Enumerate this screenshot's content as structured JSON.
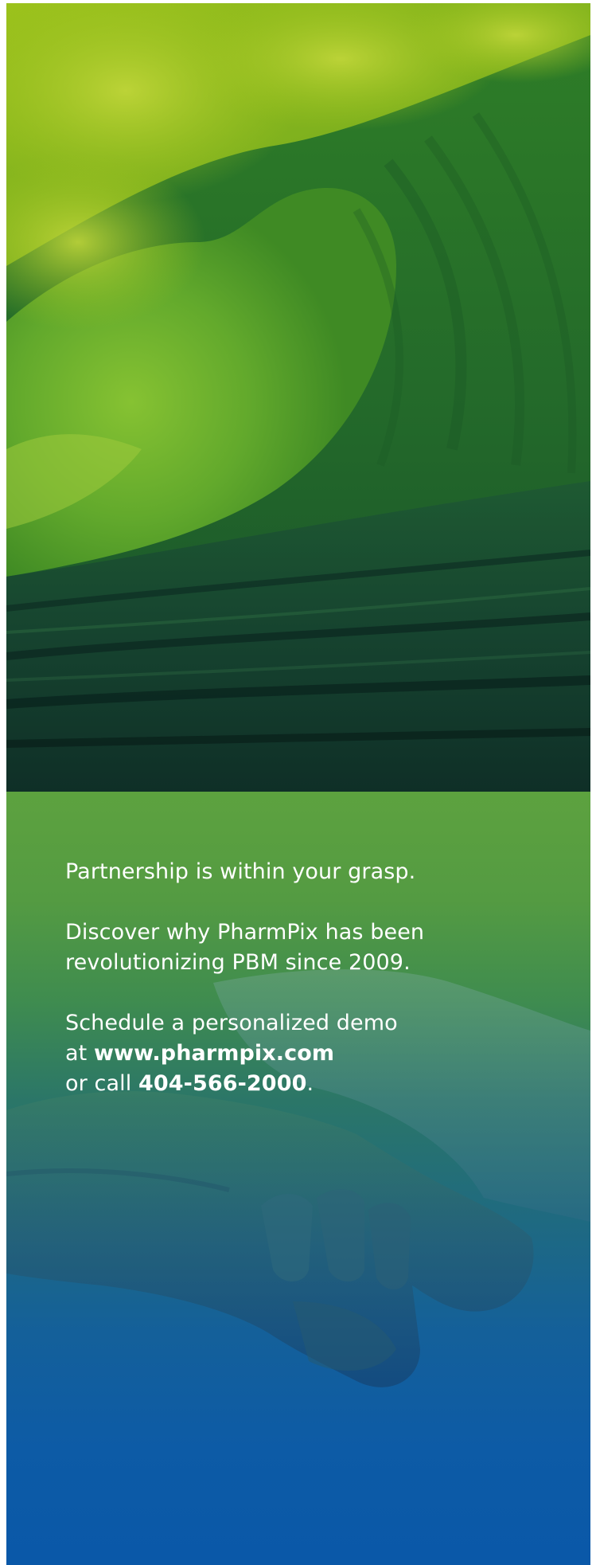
{
  "ad": {
    "images": {
      "top": "ocean-wave-photo",
      "bottom": "clasped-hands-photo"
    },
    "colors": {
      "wave_highlight": "#a8c81e",
      "wave_green": "#2f7d23",
      "sea_dark": "#0f2f27",
      "panel_top": "#5da23f",
      "panel_bottom": "#0a58a8",
      "text": "#ffffff"
    },
    "copy": {
      "line1": "Partnership is within your grasp.",
      "line2a": "Discover why PharmPix has been",
      "line2b": "revolutionizing PBM since 2009.",
      "line3a": "Schedule a personalized demo",
      "line3b_prefix": "at ",
      "line3b_url": "www.pharmpix.com",
      "line3c_prefix": "or call ",
      "line3c_phone": "404-566-2000",
      "line3c_suffix": "."
    }
  }
}
